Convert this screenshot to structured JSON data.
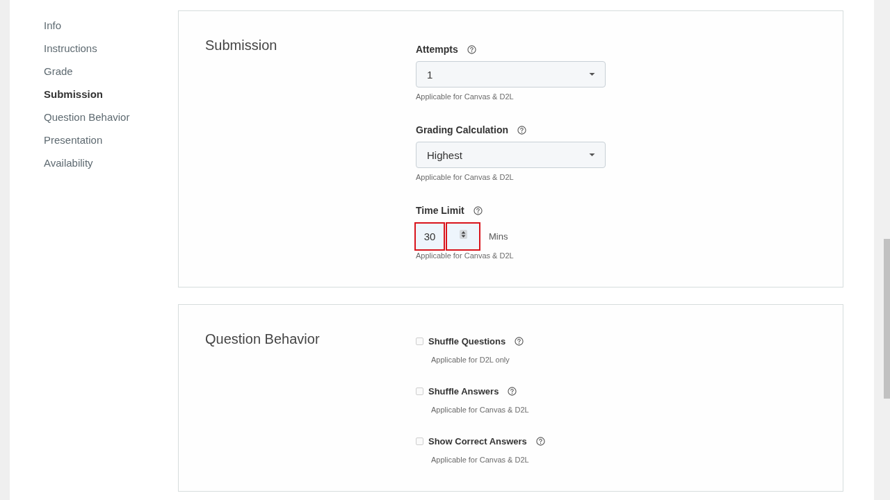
{
  "sidebar": {
    "items": [
      {
        "label": "Info",
        "selected": false
      },
      {
        "label": "Instructions",
        "selected": false
      },
      {
        "label": "Grade",
        "selected": false
      },
      {
        "label": "Submission",
        "selected": true
      },
      {
        "label": "Question Behavior",
        "selected": false
      },
      {
        "label": "Presentation",
        "selected": false
      },
      {
        "label": "Availability",
        "selected": false
      }
    ]
  },
  "sections": [
    {
      "title": "Submission",
      "fields": [
        {
          "kind": "select",
          "label": "Attempts",
          "value": "1",
          "hint": "Applicable for Canvas & D2L"
        },
        {
          "kind": "select",
          "label": "Grading Calculation",
          "value": "Highest",
          "hint": "Applicable for Canvas & D2L"
        },
        {
          "kind": "number",
          "label": "Time Limit",
          "value": "30",
          "unit": "Mins",
          "highlighted": true,
          "hint": "Applicable for Canvas & D2L"
        }
      ]
    },
    {
      "title": "Question Behavior",
      "fields": [
        {
          "kind": "checkbox",
          "label": "Shuffle Questions",
          "checked": false,
          "hint": "Applicable for D2L only"
        },
        {
          "kind": "checkbox",
          "label": "Shuffle Answers",
          "checked": false,
          "hint": "Applicable for Canvas & D2L"
        },
        {
          "kind": "checkbox",
          "label": "Show Correct Answers",
          "checked": false,
          "hint": "Applicable for Canvas & D2L"
        }
      ]
    }
  ]
}
